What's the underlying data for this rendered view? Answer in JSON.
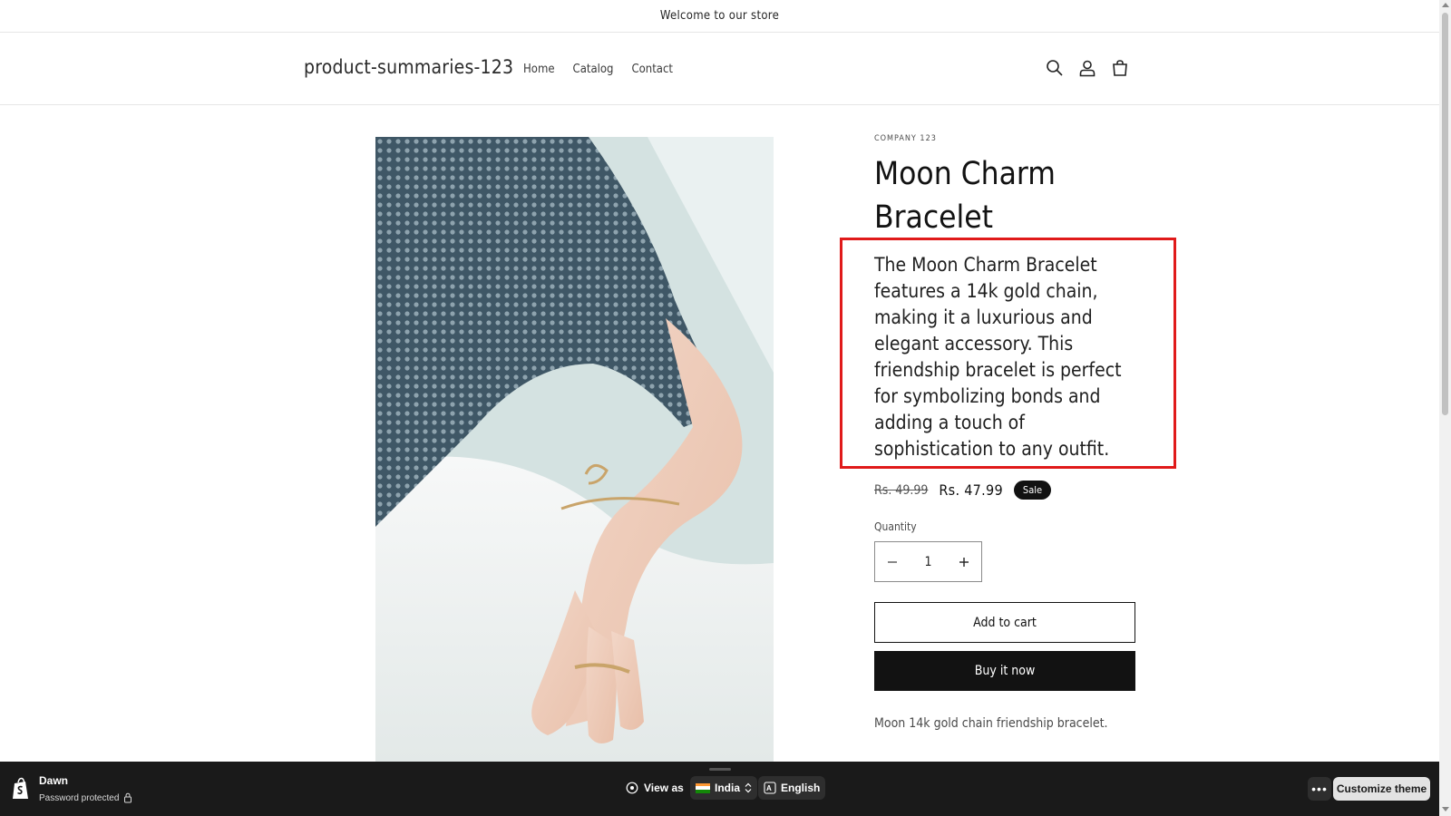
{
  "announcement": {
    "text": "Welcome to our store"
  },
  "header": {
    "logo": "product-summaries-123",
    "nav": [
      {
        "label": "Home"
      },
      {
        "label": "Catalog"
      },
      {
        "label": "Contact"
      }
    ],
    "icons": [
      "search-icon",
      "account-icon",
      "cart-icon"
    ]
  },
  "product": {
    "vendor": "COMPANY 123",
    "title_line1": "Moon Charm",
    "title_line2": "Bracelet",
    "description": "The Moon Charm Bracelet features a 14k gold chain, making it a luxurious and elegant accessory. This friendship bracelet is perfect for symbolizing bonds and adding a touch of sophistication to any outfit.",
    "old_price": "Rs. 49.99",
    "new_price": "Rs. 47.99",
    "sale_badge": "Sale",
    "quantity_label": "Quantity",
    "quantity_value": "1",
    "add_to_cart": "Add to cart",
    "buy_now": "Buy it now",
    "short_description": "Moon 14k gold chain friendship bracelet."
  },
  "admin_bar": {
    "theme_name": "Dawn",
    "status": "Password protected",
    "view_as": "View as",
    "country": "India",
    "language": "English",
    "more": "•••",
    "customize": "Customize theme"
  },
  "colors": {
    "highlight": "#e01a1a",
    "primary": "#121212",
    "admin_bg": "#1a1a1a"
  }
}
